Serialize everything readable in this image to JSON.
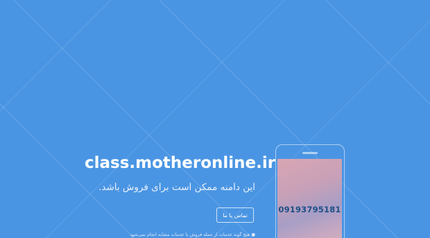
{
  "domain_name": "class.motheronline.ir",
  "tagline": "این دامنه ممکن است برای فروش باشد.",
  "contact_button_label": "تماس با ما",
  "footnote": "● هیچ گونه خدمات از جمله فروش یا خدمات مشابه انجام نمی‌شود",
  "phone_number": "09193795181",
  "colors": {
    "background": "#4a95e3",
    "text": "#ffffff",
    "phone_number": "#1d4e86"
  }
}
